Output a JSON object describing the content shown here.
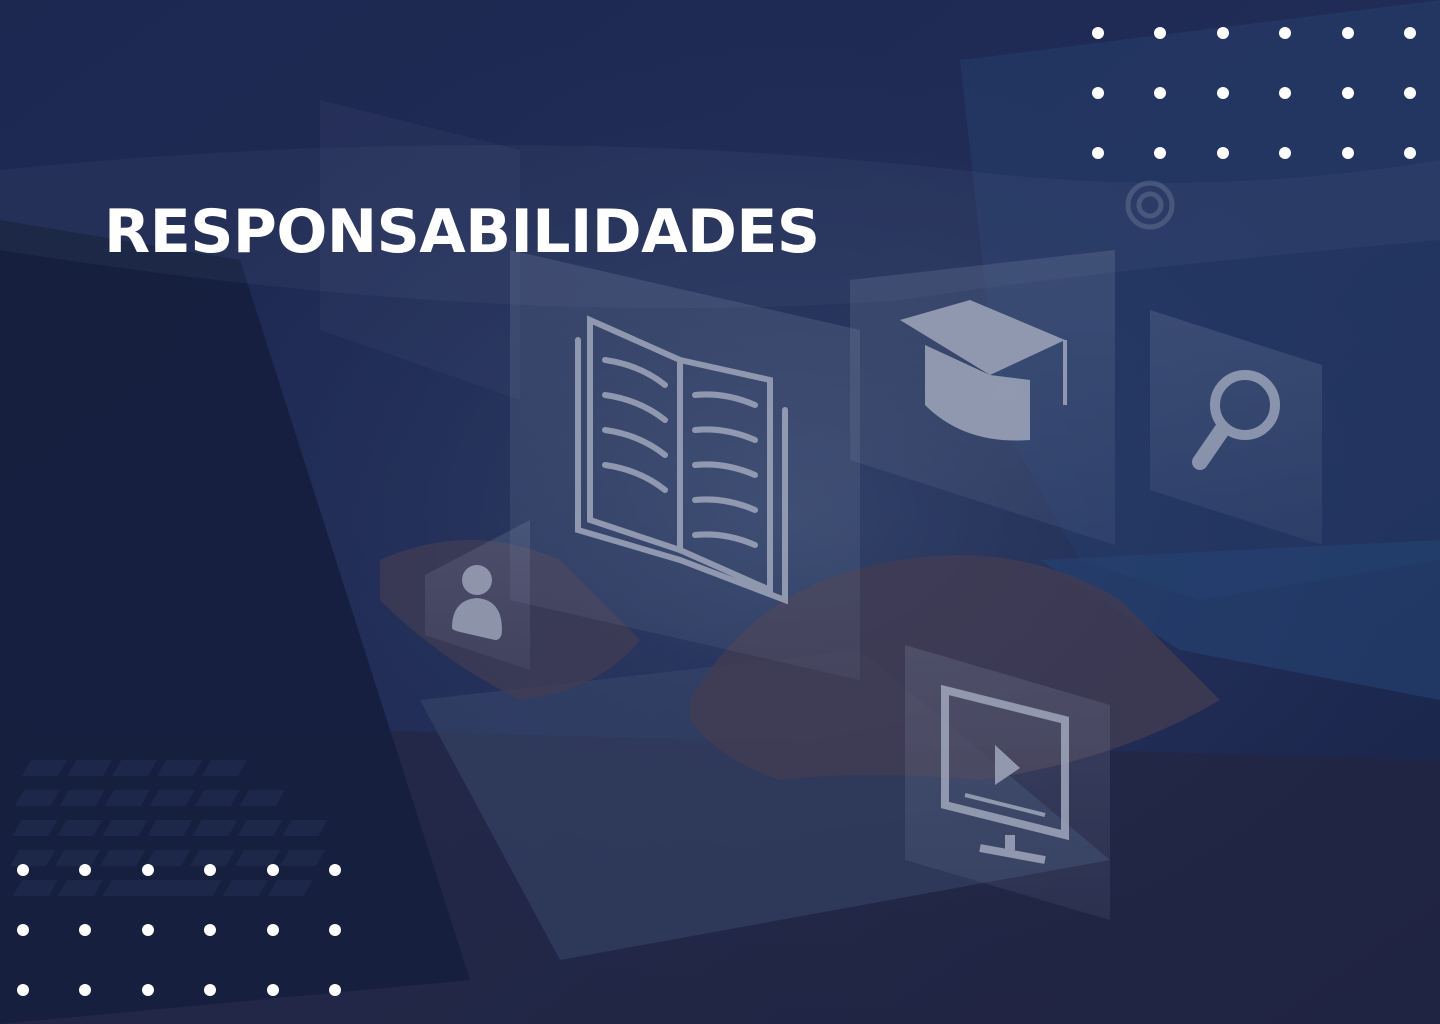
{
  "slide": {
    "title": "RESPONSABILIDADES"
  },
  "colors": {
    "overlay": "#1b2650",
    "title_text": "#ffffff",
    "dots": "#ffffff"
  },
  "icons": [
    "book-icon",
    "graduation-cap-icon",
    "magnifier-icon",
    "user-icon",
    "video-screen-icon",
    "target-icon"
  ]
}
